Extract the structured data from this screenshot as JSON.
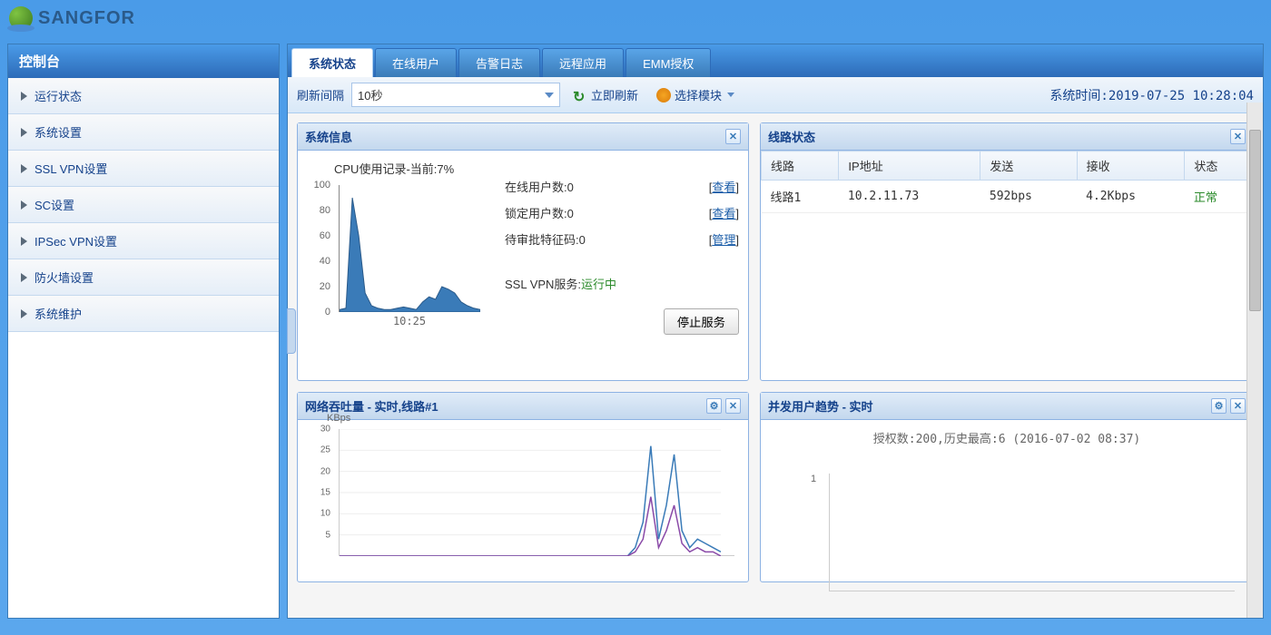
{
  "logo_text": "SANGFOR",
  "sidebar": {
    "title": "控制台",
    "items": [
      "运行状态",
      "系统设置",
      "SSL VPN设置",
      "SC设置",
      "IPSec VPN设置",
      "防火墙设置",
      "系统维护"
    ]
  },
  "tabs": [
    "系统状态",
    "在线用户",
    "告警日志",
    "远程应用",
    "EMM授权"
  ],
  "active_tab": 0,
  "toolbar": {
    "refresh_interval_label": "刷新间隔",
    "refresh_interval_value": "10秒",
    "refresh_now": "立即刷新",
    "select_module": "选择模块",
    "time_label": "系统时间:",
    "time_value": "2019-07-25 10:28:04"
  },
  "panels": {
    "sysinfo": {
      "title": "系统信息",
      "cpu_label_prefix": "CPU使用记录-当前:",
      "cpu_current": "7%",
      "online_users_label": "在线用户数:",
      "online_users_value": "0",
      "view_link": "查看",
      "locked_users_label": "锁定用户数:",
      "locked_users_value": "0",
      "pending_codes_label": "待审批特征码:",
      "pending_codes_value": "0",
      "manage_link": "管理",
      "vpn_service_label": "SSL VPN服务:",
      "vpn_service_status": "运行中",
      "stop_service": "停止服务"
    },
    "linestatus": {
      "title": "线路状态",
      "headers": [
        "线路",
        "IP地址",
        "发送",
        "接收",
        "状态"
      ],
      "rows": [
        {
          "line": "线路1",
          "ip": "10.2.11.73",
          "send": "592bps",
          "recv": "4.2Kbps",
          "status": "正常"
        }
      ]
    },
    "throughput": {
      "title": "网络吞吐量 - 实时,线路#1",
      "unit": "KBps"
    },
    "usertrend": {
      "title": "并发用户趋势 - 实时",
      "subtitle": "授权数:200,历史最高:6 (2016-07-02 08:37)"
    }
  },
  "chart_data": [
    {
      "type": "area",
      "id": "cpu",
      "title": "CPU使用记录-当前:7%",
      "ylabel": "%",
      "ylim": [
        0,
        100
      ],
      "y_ticks": [
        0,
        20,
        40,
        60,
        80,
        100
      ],
      "x_label": "10:25",
      "values": [
        2,
        3,
        90,
        60,
        15,
        5,
        3,
        2,
        2,
        3,
        4,
        3,
        2,
        8,
        12,
        10,
        20,
        18,
        15,
        8,
        5,
        3,
        2
      ]
    },
    {
      "type": "line",
      "id": "throughput",
      "title": "网络吞吐量 - 实时,线路#1",
      "ylabel": "KBps",
      "ylim": [
        0,
        30
      ],
      "y_ticks": [
        5,
        10,
        15,
        20,
        25,
        30
      ],
      "series": [
        {
          "name": "recv",
          "values": [
            0,
            0,
            0,
            0,
            0,
            0,
            0,
            0,
            0,
            0,
            0,
            0,
            0,
            0,
            0,
            0,
            0,
            0,
            0,
            0,
            0,
            0,
            0,
            0,
            0,
            0,
            0,
            0,
            0,
            0,
            0,
            0,
            0,
            0,
            0,
            0,
            0,
            0,
            2,
            8,
            26,
            4,
            12,
            24,
            6,
            2,
            4,
            3,
            2,
            1
          ]
        },
        {
          "name": "send",
          "values": [
            0,
            0,
            0,
            0,
            0,
            0,
            0,
            0,
            0,
            0,
            0,
            0,
            0,
            0,
            0,
            0,
            0,
            0,
            0,
            0,
            0,
            0,
            0,
            0,
            0,
            0,
            0,
            0,
            0,
            0,
            0,
            0,
            0,
            0,
            0,
            0,
            0,
            0,
            1,
            4,
            14,
            2,
            6,
            12,
            3,
            1,
            2,
            1,
            1,
            0
          ]
        }
      ]
    },
    {
      "type": "line",
      "id": "usertrend",
      "title": "并发用户趋势 - 实时",
      "subtitle": "授权数:200,历史最高:6 (2016-07-02 08:37)",
      "y_ticks": [
        1
      ],
      "values": [
        0,
        0,
        0,
        0,
        0,
        0
      ]
    }
  ]
}
